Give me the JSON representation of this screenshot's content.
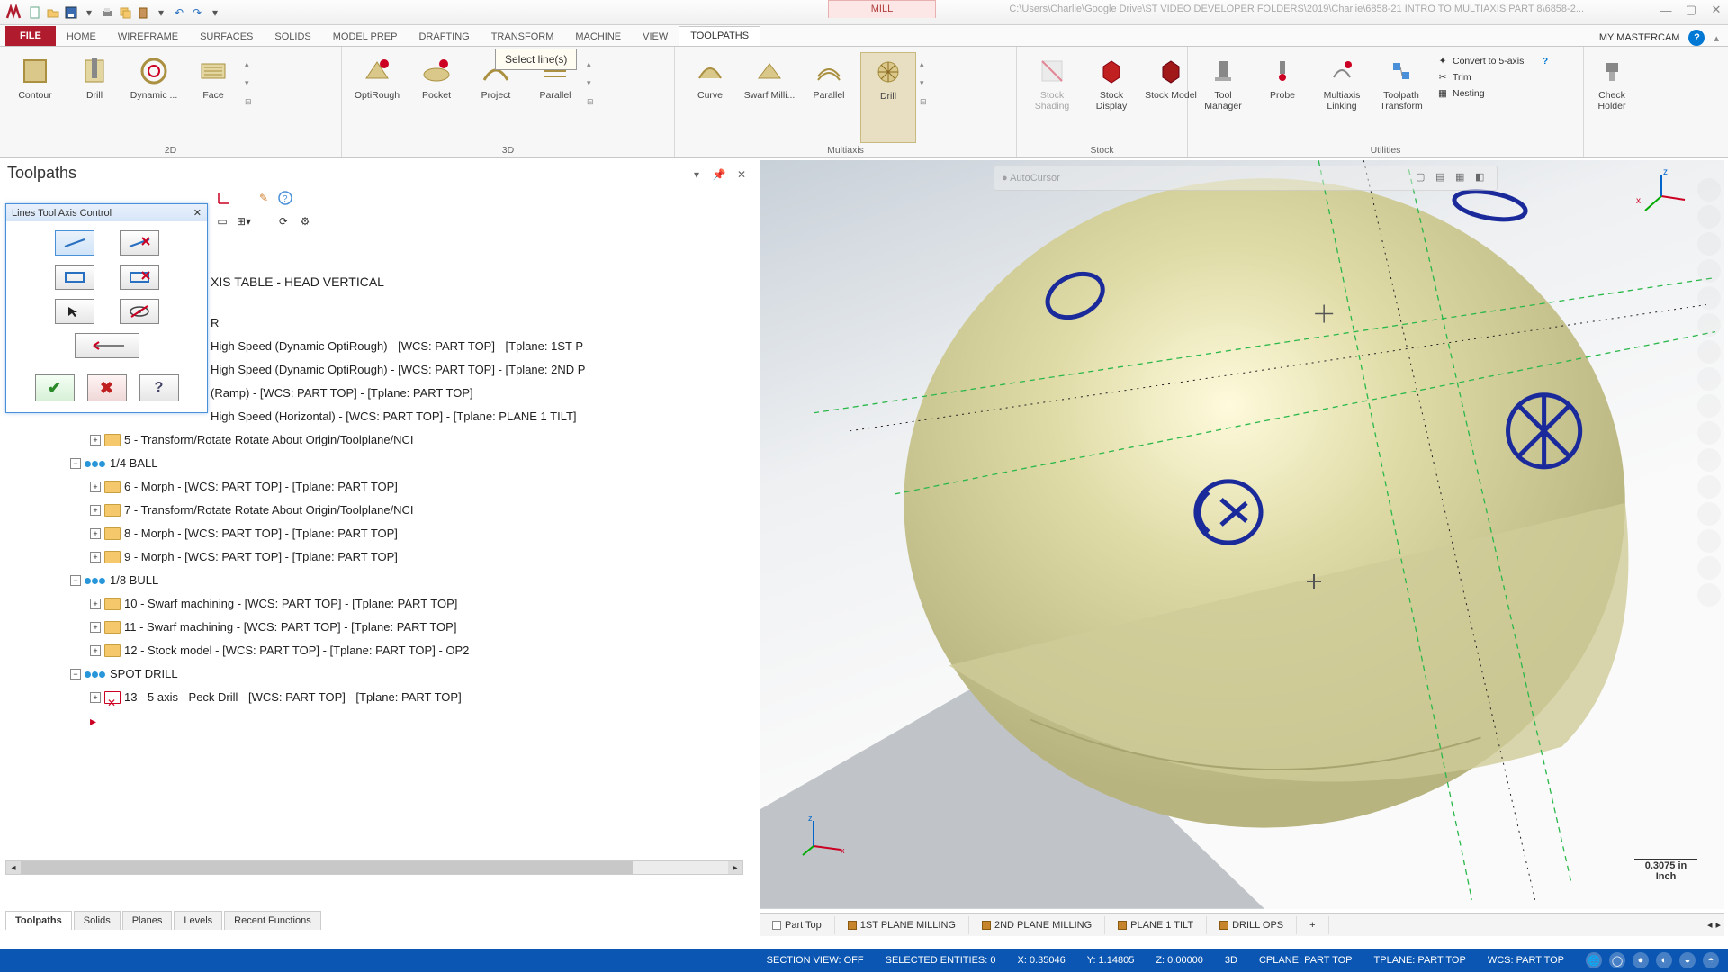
{
  "titlebar": {
    "contextual_tab": "MILL",
    "path": "C:\\Users\\Charlie\\Google Drive\\ST VIDEO DEVELOPER FOLDERS\\2019\\Charlie\\6858-21 INTRO TO MULTIAXIS PART 8\\6858-2..."
  },
  "ribbon": {
    "file_label": "FILE",
    "tabs": {
      "home": "HOME",
      "wireframe": "WIREFRAME",
      "surfaces": "SURFACES",
      "solids": "SOLIDS",
      "modelprep": "MODEL PREP",
      "drafting": "DRAFTING",
      "transform": "TRANSFORM",
      "machine": "MACHINE",
      "view": "VIEW",
      "toolpaths": "TOOLPATHS"
    },
    "right": {
      "my": "MY MASTERCAM"
    },
    "g2d": {
      "contour": "Contour",
      "drill": "Drill",
      "dynamic": "Dynamic ...",
      "face": "Face",
      "label": "2D"
    },
    "g3d": {
      "optirough": "OptiRough",
      "pocket": "Pocket",
      "project": "Project",
      "parallel": "Parallel",
      "label": "3D"
    },
    "gmulti": {
      "curve": "Curve",
      "swarf": "Swarf Milli...",
      "parallel": "Parallel",
      "drill": "Drill",
      "label": "Multiaxis"
    },
    "gstock": {
      "shading": "Stock Shading",
      "display": "Stock Display",
      "model": "Stock Model",
      "label": "Stock"
    },
    "gutil": {
      "toolmgr": "Tool Manager",
      "probe": "Probe",
      "linking": "Multiaxis Linking",
      "tptrans": "Toolpath Transform",
      "label": "Utilities",
      "convert": "Convert to 5-axis",
      "trim": "Trim",
      "nest": "Nesting",
      "check": "Check Holder"
    }
  },
  "tooltip": "Select line(s)",
  "panel": {
    "title": "Toolpaths",
    "dialog_title": "Lines Tool Axis Control",
    "tree": {
      "heading": "XIS TABLE - HEAD VERTICAL",
      "r_line": "R",
      "op1": "High Speed (Dynamic OptiRough) - [WCS: PART TOP] - [Tplane: 1ST P",
      "op2": "High Speed (Dynamic OptiRough) - [WCS: PART TOP] - [Tplane: 2ND P",
      "op3": "(Ramp) - [WCS: PART TOP] - [Tplane: PART TOP]",
      "op4": "High Speed (Horizontal) - [WCS: PART TOP] - [Tplane: PLANE 1 TILT]",
      "op5": "5 - Transform/Rotate Rotate About Origin/Toolplane/NCI",
      "grp_ball": "1/4 BALL",
      "op6": "6 - Morph - [WCS: PART TOP] - [Tplane: PART TOP]",
      "op7": "7 - Transform/Rotate Rotate About Origin/Toolplane/NCI",
      "op8": "8 - Morph - [WCS: PART TOP] - [Tplane: PART TOP]",
      "op9": "9 - Morph - [WCS: PART TOP] - [Tplane: PART TOP]",
      "grp_bull": "1/8 BULL",
      "op10": "10 - Swarf machining - [WCS: PART TOP] - [Tplane: PART TOP]",
      "op11": "11 - Swarf machining - [WCS: PART TOP] - [Tplane: PART TOP]",
      "op12": "12 - Stock model - [WCS: PART TOP] - [Tplane: PART TOP] - OP2",
      "grp_spot": "SPOT DRILL",
      "op13": "13 - 5 axis - Peck Drill - [WCS: PART TOP] - [Tplane: PART TOP]"
    },
    "bottom_tabs": {
      "toolpaths": "Toolpaths",
      "solids": "Solids",
      "planes": "Planes",
      "levels": "Levels",
      "recent": "Recent Functions"
    }
  },
  "viewport": {
    "autocursor": "AutoCursor",
    "scale_value": "0.3075 in",
    "scale_unit": "Inch",
    "view_tabs": {
      "parttop": "Part Top",
      "p1": "1ST PLANE MILLING",
      "p2": "2ND PLANE MILLING",
      "p3": "PLANE 1 TILT",
      "p4": "DRILL OPS"
    }
  },
  "status": {
    "section": "SECTION VIEW: OFF",
    "selected": "SELECTED ENTITIES: 0",
    "x": "X: 0.35046",
    "y": "Y: 1.14805",
    "z": "Z: 0.00000",
    "mode": "3D",
    "cplane": "CPLANE: PART TOP",
    "tplane": "TPLANE: PART TOP",
    "wcs": "WCS: PART TOP"
  }
}
